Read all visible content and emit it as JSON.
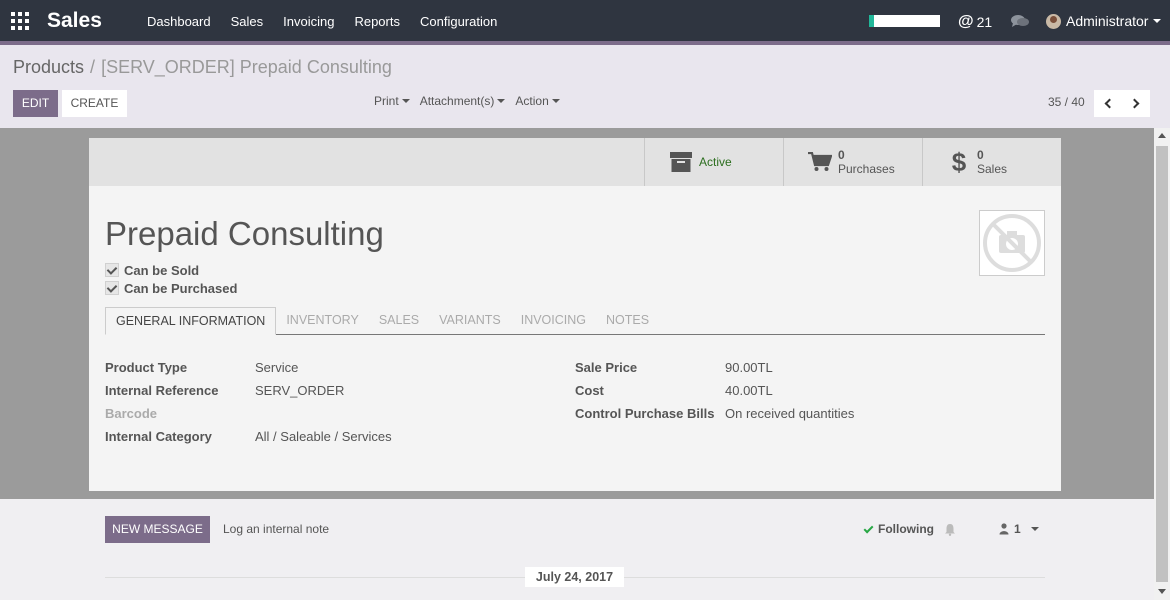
{
  "navbar": {
    "app_name": "Sales",
    "menu": [
      "Dashboard",
      "Sales",
      "Invoicing",
      "Reports",
      "Configuration"
    ],
    "progress_fraction": 0.07,
    "mentions_count": "21",
    "user_name": "Administrator"
  },
  "breadcrumb": {
    "parent": "Products",
    "separator": "/",
    "current": "[SERV_ORDER] Prepaid Consulting"
  },
  "controls": {
    "edit_label": "EDIT",
    "create_label": "CREATE",
    "print_label": "Print",
    "attachments_label": "Attachment(s)",
    "action_label": "Action",
    "pager": "35 / 40"
  },
  "stat_buttons": {
    "active_label": "Active",
    "purchases_count": "0",
    "purchases_label": "Purchases",
    "sales_count": "0",
    "sales_label": "Sales"
  },
  "product": {
    "name": "Prepaid Consulting",
    "can_be_sold_label": "Can be Sold",
    "can_be_purchased_label": "Can be Purchased"
  },
  "tabs": [
    "GENERAL INFORMATION",
    "INVENTORY",
    "SALES",
    "VARIANTS",
    "INVOICING",
    "NOTES"
  ],
  "fields_left": [
    {
      "label": "Product Type",
      "value": "Service"
    },
    {
      "label": "Internal Reference",
      "value": "SERV_ORDER"
    },
    {
      "label": "Barcode",
      "value": ""
    },
    {
      "label": "Internal Category",
      "value": "All / Saleable / Services"
    }
  ],
  "fields_right": [
    {
      "label": "Sale Price",
      "value": "90.00TL"
    },
    {
      "label": "Cost",
      "value": "40.00TL"
    },
    {
      "label": "Control Purchase Bills",
      "value": "On received quantities"
    }
  ],
  "chatter": {
    "new_message_label": "NEW MESSAGE",
    "log_note_label": "Log an internal note",
    "following_label": "Following",
    "followers_count": "1",
    "date": "July 24, 2017"
  },
  "colors": {
    "navbar": "#2f3540",
    "accent": "#7c6c8a",
    "progress": "#21b799",
    "active_green": "#2c6e1f"
  }
}
